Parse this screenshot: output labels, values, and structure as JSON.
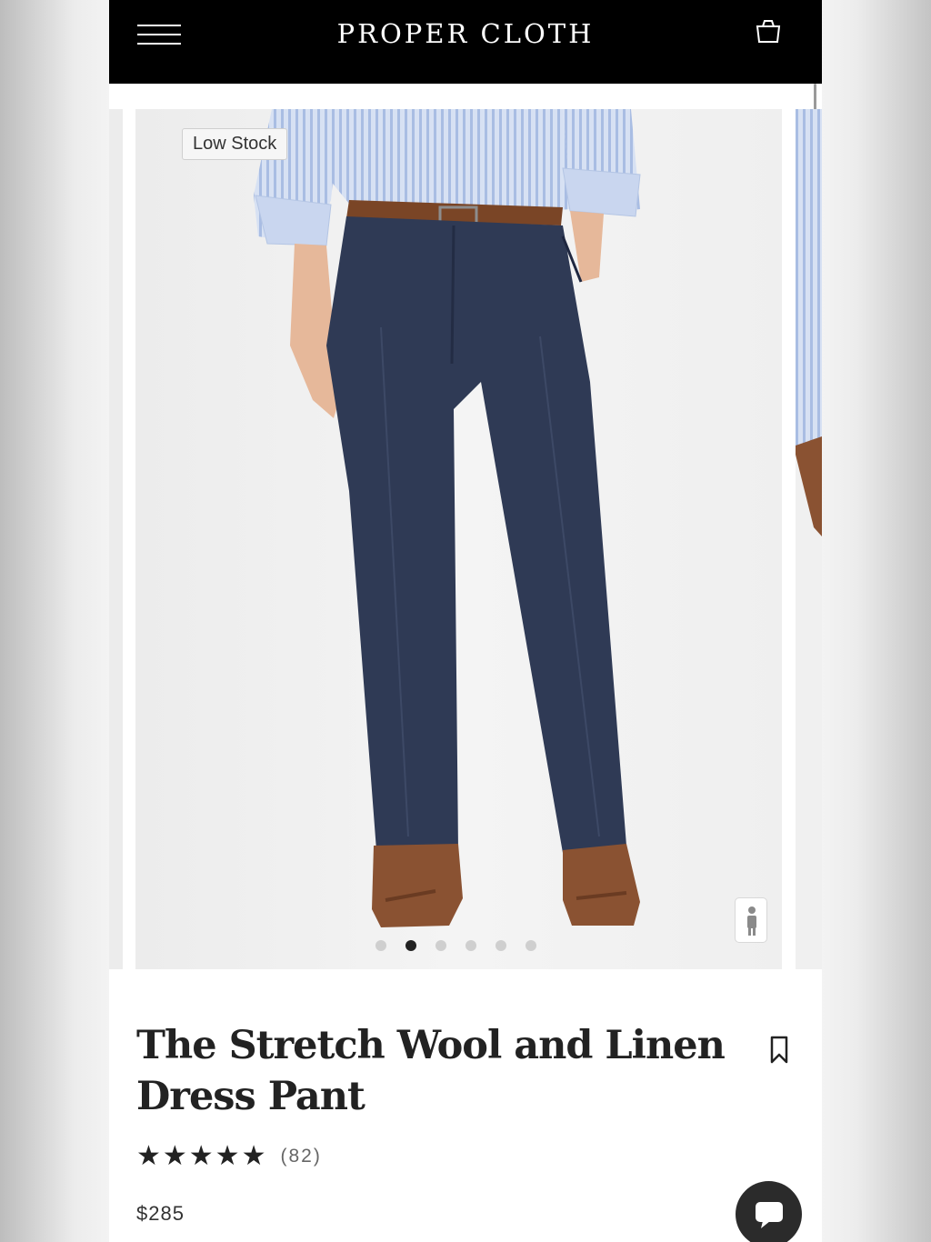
{
  "header": {
    "brand": "PROPER CLOTH",
    "menu_icon": "hamburger-menu-icon",
    "cart_icon": "shopping-bag-icon"
  },
  "product": {
    "badge": "Low Stock",
    "title": "The Stretch Wool and Linen Dress Pant",
    "stars": "★★★★★",
    "review_count": "(82)",
    "price": "$285"
  },
  "carousel": {
    "slide_count": 6,
    "active_index": 1
  },
  "icons": {
    "model_view": "person-icon",
    "bookmark": "bookmark-icon",
    "chat": "chat-icon"
  },
  "colors": {
    "header_bg": "#000000",
    "pant_navy": "#2f3a55",
    "shirt_blue": "#c9d6ef",
    "shoe_brown": "#8a5232"
  }
}
